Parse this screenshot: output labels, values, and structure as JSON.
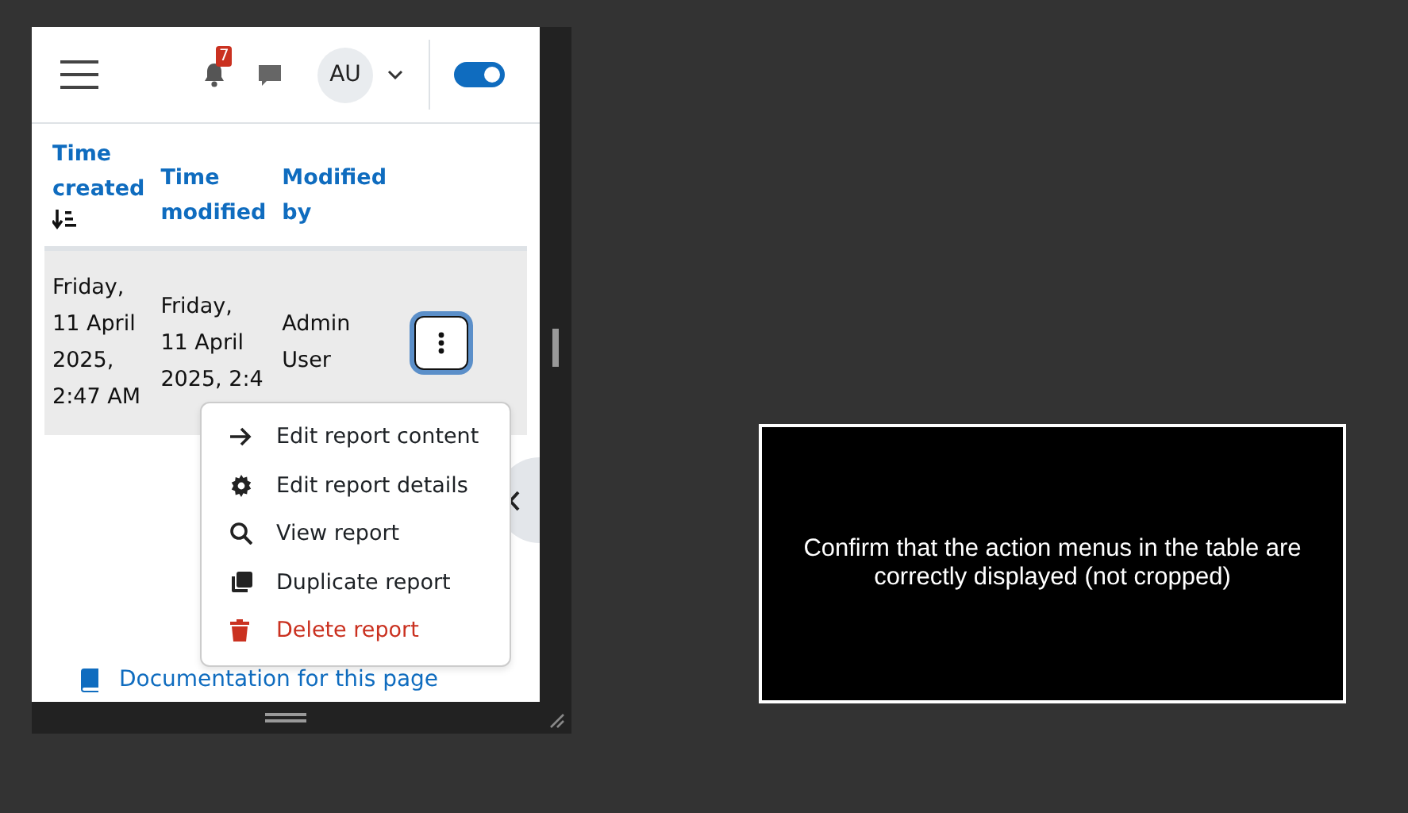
{
  "header": {
    "notification_count": "7",
    "user_initials": "AU",
    "edit_mode": {
      "on": true
    }
  },
  "table": {
    "columns": [
      {
        "label": "Time created",
        "sorted_ascending": true
      },
      {
        "label": "Time modified"
      },
      {
        "label": "Modified by"
      }
    ],
    "rows": [
      {
        "cells": [
          "Friday, 11 April 2025, 2:47 AM",
          "Friday, 11 April 2025, 2:4",
          "Admin User"
        ]
      }
    ]
  },
  "action_menu": {
    "items": [
      {
        "label": "Edit report content",
        "kind": "arrow",
        "danger": false
      },
      {
        "label": "Edit report details",
        "kind": "gear",
        "danger": false
      },
      {
        "label": "View report",
        "kind": "search",
        "danger": false
      },
      {
        "label": "Duplicate report",
        "kind": "copy",
        "danger": false
      },
      {
        "label": "Delete report",
        "kind": "trash",
        "danger": true
      }
    ]
  },
  "footer_links": [
    {
      "label": "Documentation for this page",
      "kind": "book"
    }
  ],
  "message": "Confirm that the action menus in the table are correctly displayed (not cropped)"
}
